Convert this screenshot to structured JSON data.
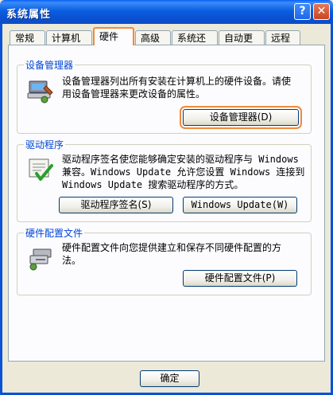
{
  "window": {
    "title": "系统属性"
  },
  "titlebar": {
    "help_label": "?",
    "close_label": "✕"
  },
  "tabs": [
    {
      "label": "常规"
    },
    {
      "label": "计算机名"
    },
    {
      "label": "硬件"
    },
    {
      "label": "高级"
    },
    {
      "label": "系统还原"
    },
    {
      "label": "自动更新"
    },
    {
      "label": "远程"
    }
  ],
  "device_manager": {
    "group_title": "设备管理器",
    "description_line1": "设备管理器列出所有安装在计算机上的硬件设备。请使",
    "description_line2": "用设备管理器来更改设备的属性。",
    "button_label": "设备管理器(D)",
    "icon": "device-manager-icon"
  },
  "drivers": {
    "group_title": "驱动程序",
    "description_line1": "驱动程序签名使您能够确定安装的驱动程序与 Windows",
    "description_line2": "兼容。Windows Update 允许您设置 Windows 连接到",
    "description_line3": "Windows Update 搜索驱动程序的方式。",
    "signing_button_label": "驱动程序签名(S)",
    "update_button_label": "Windows Update(W)",
    "icon": "driver-signing-icon"
  },
  "hardware_profiles": {
    "group_title": "硬件配置文件",
    "description_line1": "硬件配置文件向您提供建立和保存不同硬件配置的方",
    "description_line2": "法。",
    "button_label": "硬件配置文件(P)",
    "icon": "hardware-profile-icon"
  },
  "footer": {
    "ok_label": "确定"
  },
  "colors": {
    "title_blue": "#0b5fe0",
    "group_label": "#0046d5",
    "highlight": "#f08a3c"
  }
}
